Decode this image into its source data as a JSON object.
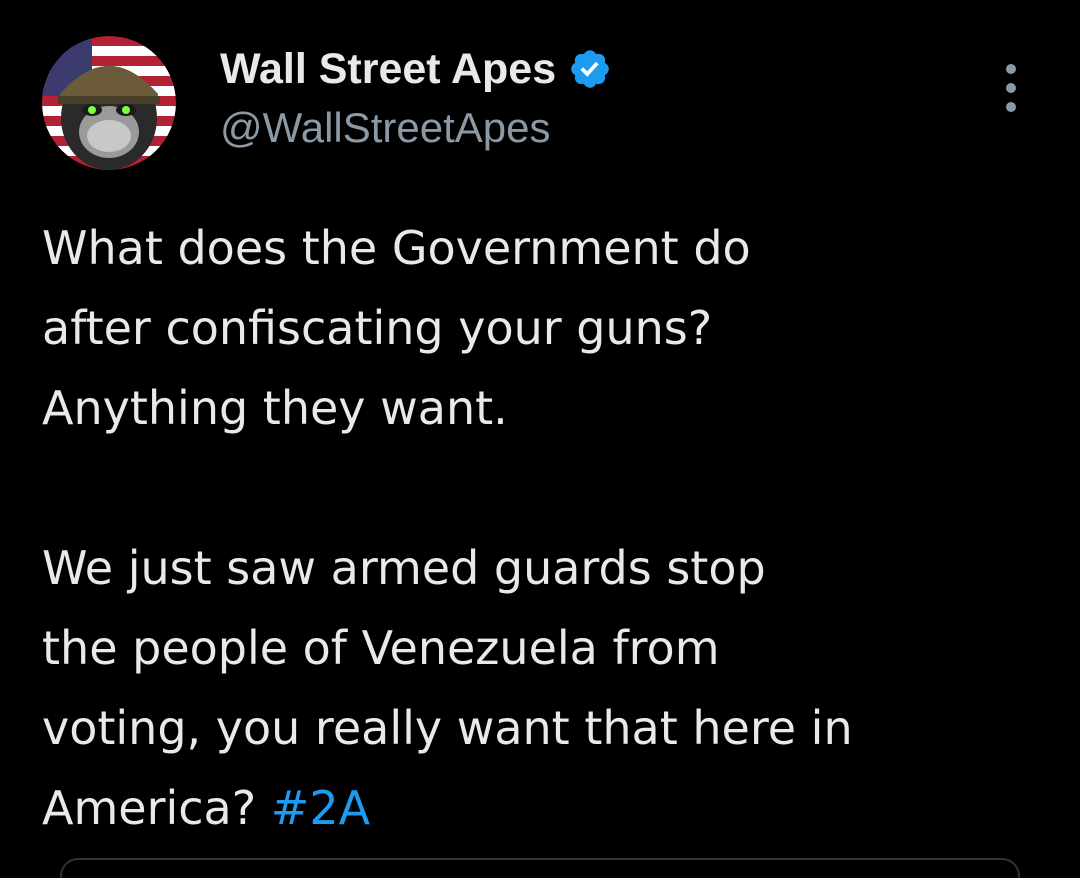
{
  "user": {
    "display_name": "Wall Street Apes",
    "handle": "@WallStreetApes",
    "verified": true
  },
  "tweet": {
    "lines": [
      "What does the Government do",
      "after confiscating your guns?",
      "Anything they want.",
      "",
      "We just saw armed guards stop",
      "the people of Venezuela from",
      "voting, you really want that here in",
      "America?"
    ],
    "hashtag": "#2A"
  },
  "icons": {
    "verified": "verified-badge-icon",
    "more": "more-options-icon"
  },
  "colors": {
    "background": "#000000",
    "text": "#e7e9ea",
    "muted": "#8b98a5",
    "link": "#1d9bf0",
    "verified_badge": "#1d9bf0"
  }
}
